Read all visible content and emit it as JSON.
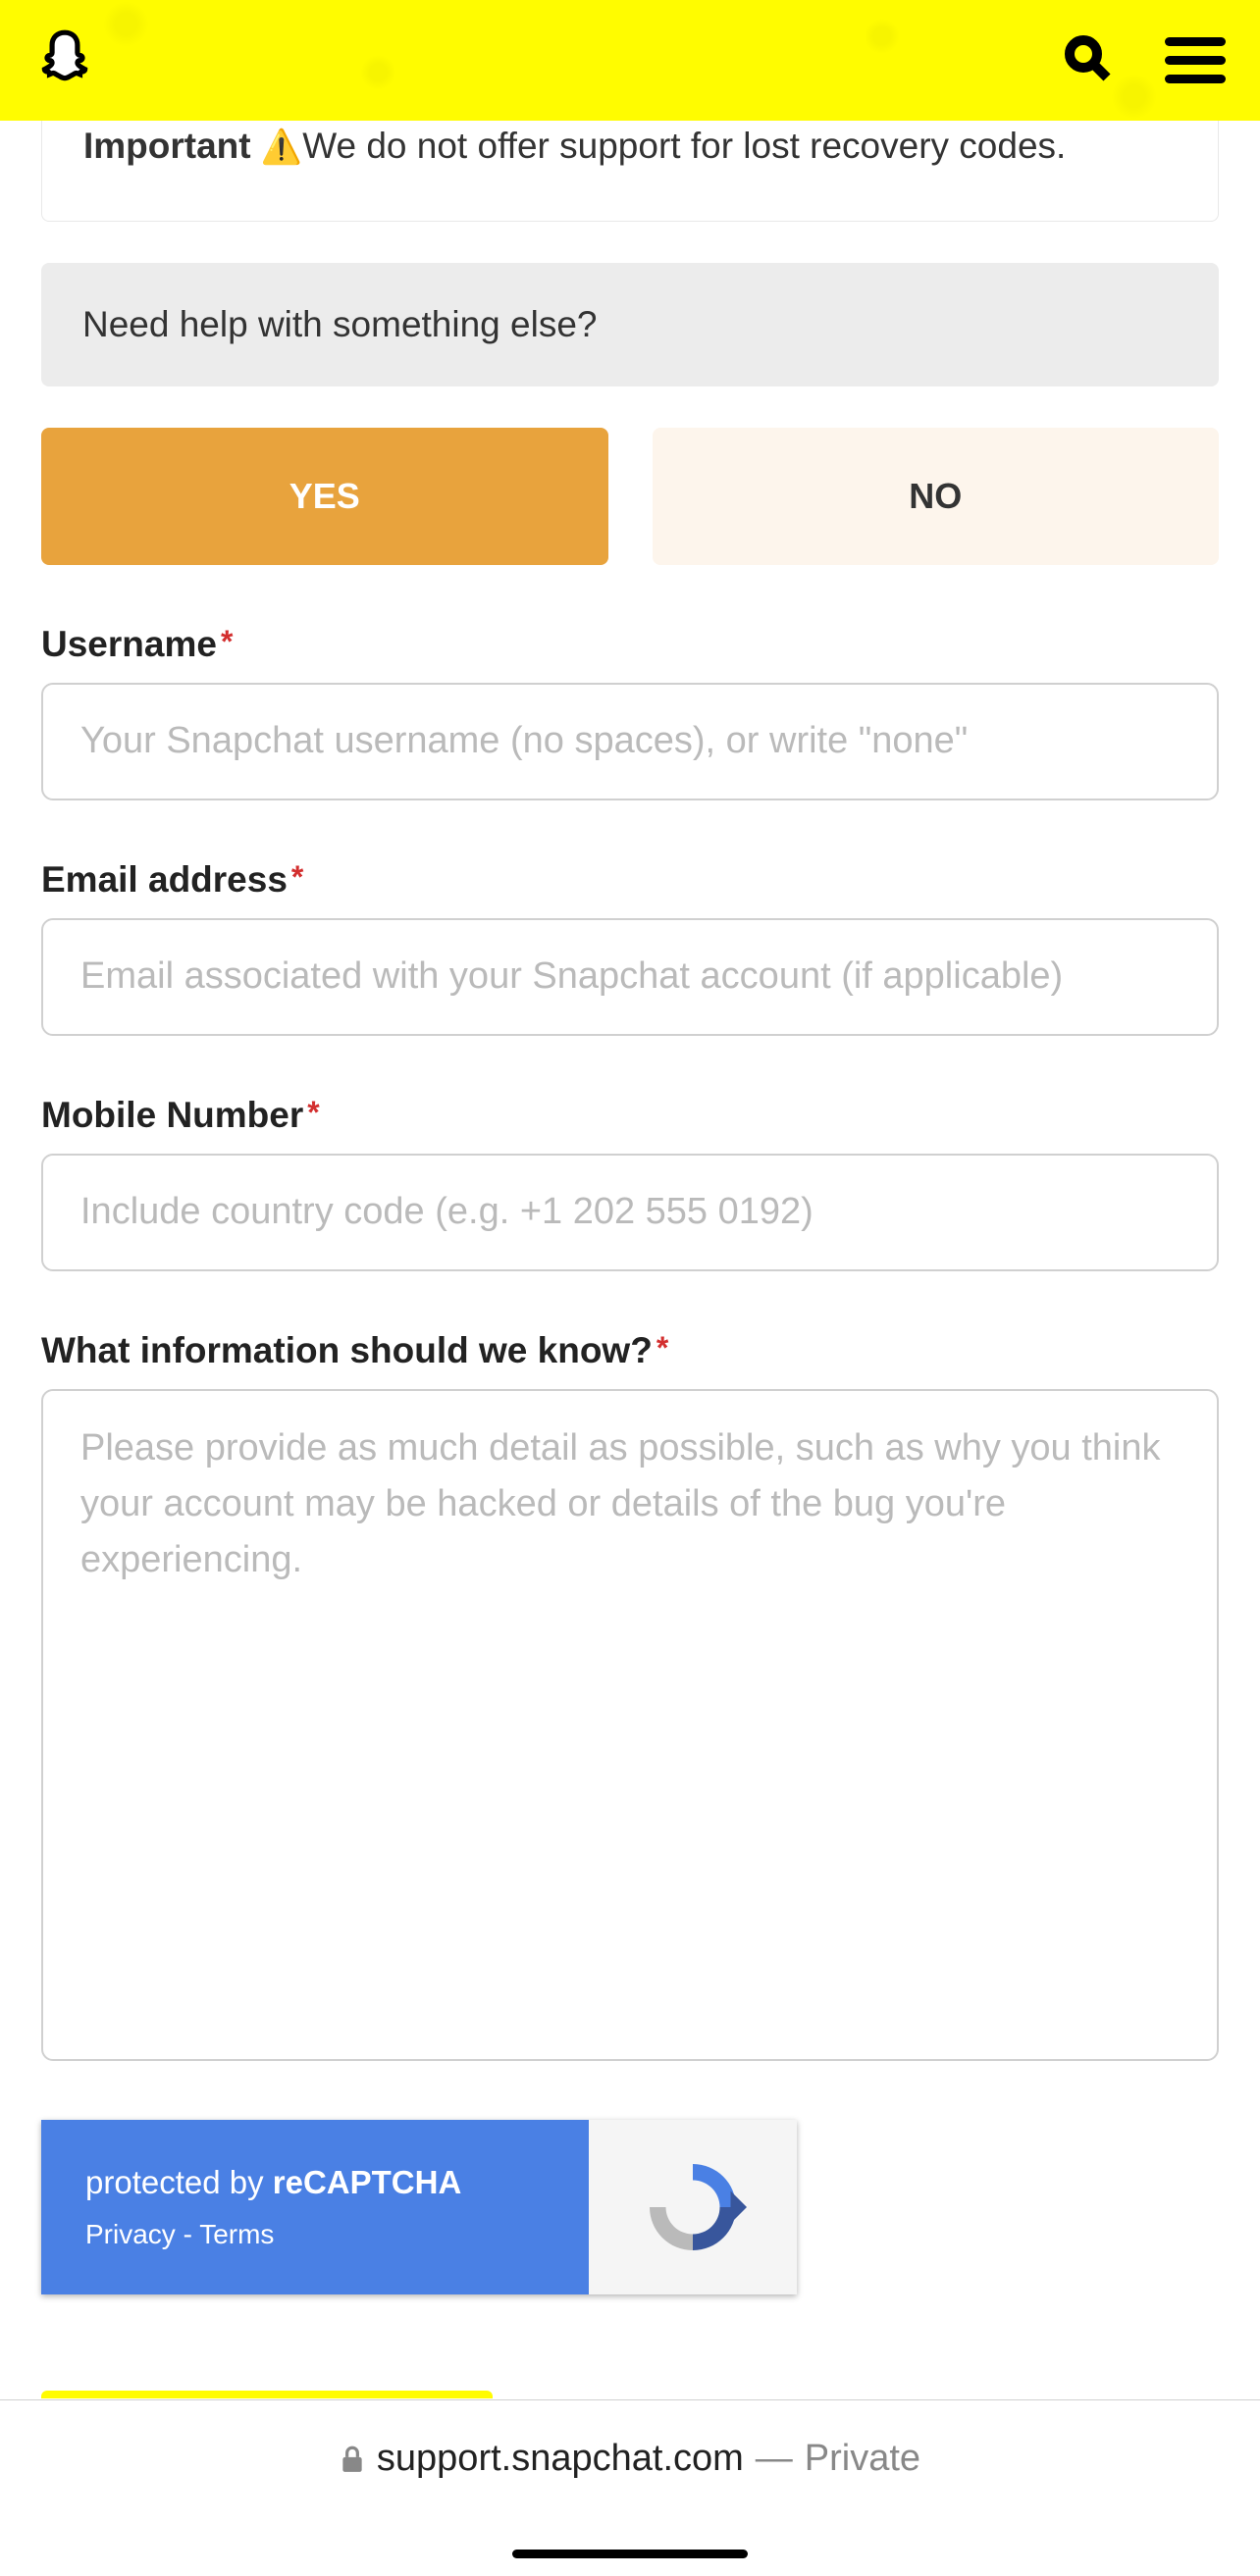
{
  "importantBox": {
    "strongLabel": "Important",
    "warnEmoji": "⚠️",
    "message": "We do not offer support for lost recovery codes."
  },
  "helpBox": {
    "text": "Need help with something else?"
  },
  "buttons": {
    "yes": "YES",
    "no": "NO"
  },
  "form": {
    "username": {
      "label": "Username",
      "placeholder": "Your Snapchat username (no spaces), or write \"none\""
    },
    "email": {
      "label": "Email address",
      "placeholder": "Email associated with your Snapchat account (if applicable)"
    },
    "mobile": {
      "label": "Mobile Number",
      "placeholder": "Include country code (e.g. +1 202 555 0192)"
    },
    "info": {
      "label": "What information should we know?",
      "placeholder": "Please provide as much detail as possible, such as why you think your account may be hacked or details of the bug you're experiencing."
    }
  },
  "recaptcha": {
    "protectedBy": "protected by ",
    "brand": "reCAPTCHA",
    "privacy": "Privacy",
    "sep": " - ",
    "terms": "Terms"
  },
  "browserBar": {
    "url": "support.snapchat.com",
    "dash": " — ",
    "private": "Private"
  }
}
